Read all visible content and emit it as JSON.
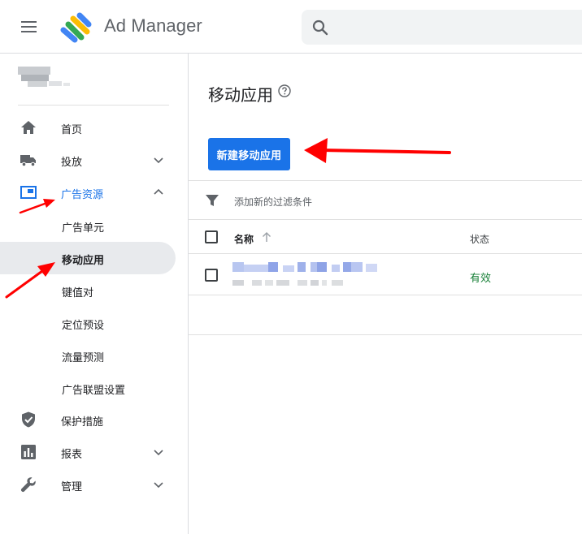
{
  "app": {
    "product_name": "Ad Manager"
  },
  "search": {
    "placeholder": ""
  },
  "sidebar": {
    "items": [
      {
        "label": "首页",
        "icon": "home-icon"
      },
      {
        "label": "投放",
        "icon": "truck-icon",
        "expandable": true
      },
      {
        "label": "广告资源",
        "icon": "inventory-icon",
        "expanded": true,
        "active": true
      },
      {
        "label": "保护措施",
        "icon": "shield-icon"
      },
      {
        "label": "报表",
        "icon": "bar-chart-icon",
        "expandable": true
      },
      {
        "label": "管理",
        "icon": "wrench-icon",
        "expandable": true
      }
    ],
    "inventory_subitems": [
      {
        "label": "广告单元"
      },
      {
        "label": "移动应用",
        "selected": true
      },
      {
        "label": "键值对"
      },
      {
        "label": "定位预设"
      },
      {
        "label": "流量预测"
      },
      {
        "label": "广告联盟设置"
      }
    ]
  },
  "main": {
    "title": "移动应用",
    "new_button_label": "新建移动应用",
    "filter_text": "添加新的过滤条件",
    "table": {
      "columns": [
        "名称",
        "状态"
      ],
      "rows": [
        {
          "status": "有效"
        }
      ]
    }
  },
  "colors": {
    "accent_blue": "#1a73e8",
    "status_green": "#188038",
    "annotation_red": "#ff0000"
  }
}
